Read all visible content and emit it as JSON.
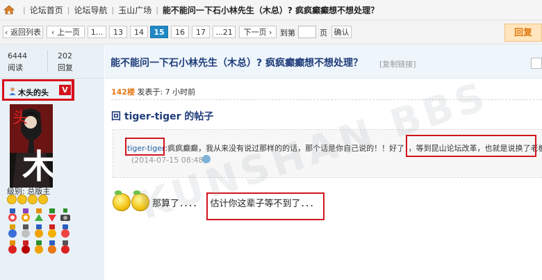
{
  "breadcrumb": {
    "items": [
      "论坛首页",
      "论坛导航",
      "玉山广场"
    ],
    "current": "能不能问一下石小林先生（木总）? 疯疯癫癫想不想处理？"
  },
  "pager": {
    "back_label": "‹ 返回列表",
    "prev_label": "‹ 上一页",
    "first_label": "1...",
    "pages": [
      "13",
      "14",
      "15",
      "16",
      "17"
    ],
    "active_page": "15",
    "last_label": "...21",
    "next_label": "下一页 ›",
    "goto_prefix": "到第",
    "goto_suffix": "页",
    "confirm_label": "确认",
    "reply_label": "回复"
  },
  "stats": {
    "views_value": "6444",
    "views_label": "阅读",
    "replies_value": "202",
    "replies_label": "回复"
  },
  "user": {
    "name": "木头的头",
    "badge": "V",
    "level": "级别: 总版主",
    "avatar_chars": [
      "头",
      "木"
    ]
  },
  "thread": {
    "title": "能不能问一下石小林先生（木总）? 疯疯癫癫想不想处理？",
    "copy_link": "[复制链接]"
  },
  "post": {
    "floor": "142楼",
    "posted": "发表于: 7 小时前",
    "reply_title": "回 tiger-tiger 的帖子",
    "quote_user": "tiger-tiger",
    "quote_text": ":疯疯癫癫，我从来没有说过那样的的话，那个话是你自己说的！！好了，，等到昆山论坛改革，也就是说换了老板，",
    "quote_time": "(2014-07-15 08:48)",
    "body_prefix": "那算了．．．．",
    "body_highlight": "估计你这辈子等不到了．．．"
  },
  "watermark": "KUNSHAN BBS",
  "colors": {
    "accent_blue": "#1f88c4",
    "title_blue": "#1f3d7a",
    "highlight_red": "#d2141c",
    "floor_orange": "#e77817"
  }
}
